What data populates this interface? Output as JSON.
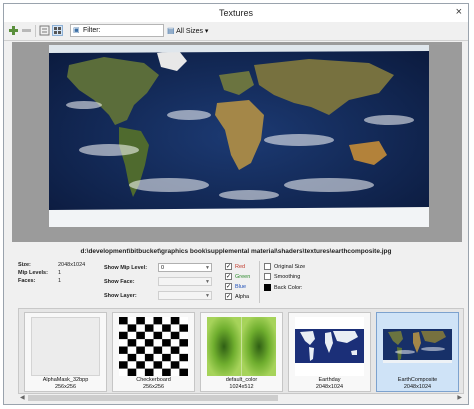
{
  "window": {
    "title": "Textures",
    "close_icon": "×"
  },
  "toolbar": {
    "filter_label": "Filter:",
    "sizes_label": "All Sizes ▾"
  },
  "preview": {
    "path": "d:\\development\\bitbucket\\graphics book\\supplemental material\\shaders\\textures\\earthcomposite.jpg"
  },
  "info": {
    "size_label": "Size:",
    "size_value": "2048x1024",
    "mip_label": "Mip Levels:",
    "mip_value": "1",
    "faces_label": "Faces:",
    "faces_value": "1",
    "show_mip_label": "Show Mip Level:",
    "show_mip_value": "0",
    "show_face_label": "Show Face:",
    "show_layer_label": "Show Layer:"
  },
  "channels": {
    "red": "Red",
    "green": "Green",
    "blue": "Blue",
    "alpha": "Alpha",
    "red_color": "#c0392b",
    "green_color": "#2e8b2e",
    "blue_color": "#1f4fb8"
  },
  "options": {
    "original_size": "Original Size",
    "smoothing": "Smoothing",
    "back_color": "Back Color:"
  },
  "thumbnails": [
    {
      "name": "AlphaMask_32bpp",
      "size": "256x256"
    },
    {
      "name": "Checkerboard",
      "size": "256x256"
    },
    {
      "name": "default_color",
      "size": "1024x512"
    },
    {
      "name": "Earthday",
      "size": "2048x1024"
    },
    {
      "name": "EarthComposite",
      "size": "2048x1024"
    }
  ]
}
